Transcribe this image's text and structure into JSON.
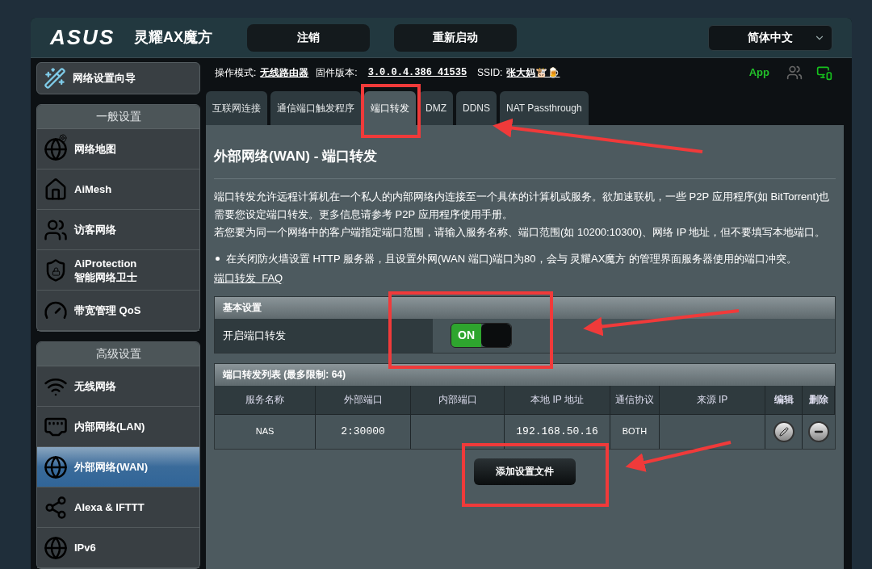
{
  "header": {
    "logo": "ASUS",
    "product": "灵耀AX魔方",
    "buttons": [
      "注销",
      "重新启动"
    ],
    "language": "简体中文"
  },
  "status_line": {
    "mode_label": "操作模式:",
    "mode": "无线路由器",
    "firmware_label": "固件版本:",
    "firmware": "3.0.0.4.386_41535",
    "ssid_label": "SSID:",
    "ssid": "张大妈🐮🍺",
    "app": "App"
  },
  "sidebar": {
    "wizard": "网络设置向导",
    "sections": [
      {
        "title": "一般设置",
        "items": [
          {
            "label": "网络地图",
            "selected": false
          },
          {
            "label": "AiMesh",
            "selected": false
          },
          {
            "label": "访客网络",
            "selected": false
          },
          {
            "label": "AiProtection",
            "sublabel": "智能网络卫士",
            "selected": false
          },
          {
            "label": "带宽管理 QoS",
            "selected": false
          }
        ]
      },
      {
        "title": "高级设置",
        "items": [
          {
            "label": "无线网络",
            "selected": false
          },
          {
            "label": "内部网络(LAN)",
            "selected": false
          },
          {
            "label": "外部网络(WAN)",
            "selected": true
          },
          {
            "label": "Alexa & IFTTT",
            "selected": false
          },
          {
            "label": "IPv6",
            "selected": false
          }
        ]
      }
    ]
  },
  "tabs": [
    {
      "label": "互联网连接",
      "selected": false
    },
    {
      "label": "通信端口触发程序",
      "selected": false
    },
    {
      "label": "端口转发",
      "selected": true
    },
    {
      "label": "DMZ",
      "selected": false
    },
    {
      "label": "DDNS",
      "selected": false
    },
    {
      "label": "NAT Passthrough",
      "selected": false
    }
  ],
  "page_title": "外部网络(WAN) - 端口转发",
  "description": [
    "端口转发允许远程计算机在一个私人的内部网络内连接至一个具体的计算机或服务。欲加速联机，一些 P2P 应用程序(如 BitTorrent)也需要您设定端口转发。更多信息请参考 P2P 应用程序使用手册。",
    "若您要为同一个网络中的客户端指定端口范围，请输入服务名称、端口范围(如 10200:10300)、网络 IP 地址，但不要填写本地端口。"
  ],
  "bullet": "在关闭防火墙设置 HTTP 服务器，且设置外网(WAN 端口)端口为80，会与 灵耀AX魔方 的管理界面服务器使用的端口冲突。",
  "faq_link": "端口转发  FAQ",
  "basic_settings": {
    "title": "基本设置",
    "label": "开启端口转发",
    "toggle": {
      "on": true,
      "text": "ON"
    }
  },
  "rule_table": {
    "title": "端口转发列表 (最多限制: 64)",
    "columns": [
      "服务名称",
      "外部端口",
      "内部端口",
      "本地 IP 地址",
      "通信协议",
      "来源 IP",
      "编辑",
      "删除"
    ],
    "rows": [
      {
        "cells": [
          "NAS",
          "2:30000",
          "",
          "192.168.50.16",
          "BOTH",
          ""
        ]
      }
    ]
  },
  "add_button": "添加设置文件"
}
